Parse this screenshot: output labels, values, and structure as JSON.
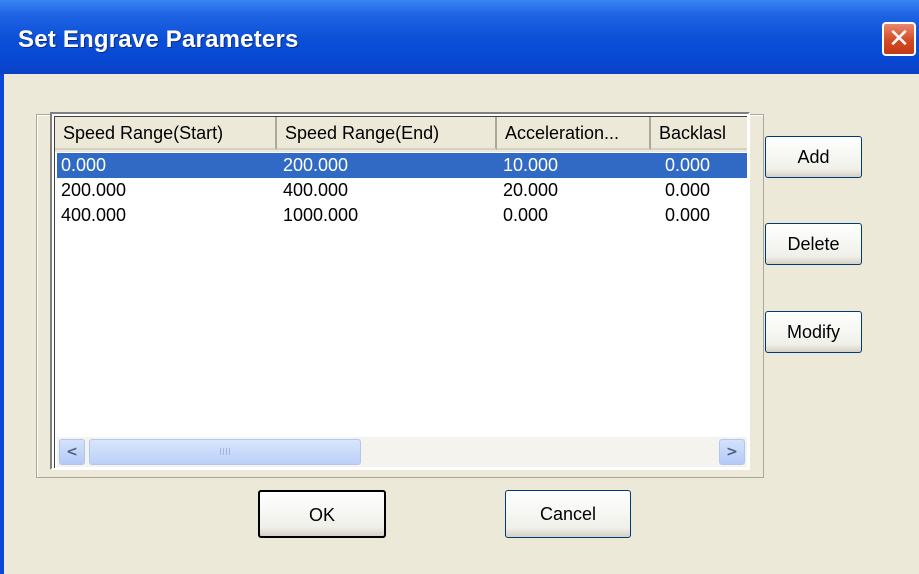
{
  "dialog": {
    "title": "Set Engrave Parameters",
    "close_glyph": "✕",
    "accent_color": "#0a46d8"
  },
  "table": {
    "columns": [
      "Speed Range(Start)",
      "Speed Range(End)",
      "Acceleration...",
      "Backlasl"
    ],
    "rows": [
      [
        "0.000",
        "200.000",
        "10.000",
        "0.000"
      ],
      [
        "200.000",
        "400.000",
        "20.000",
        "0.000"
      ],
      [
        "400.000",
        "1000.000",
        "0.000",
        "0.000"
      ]
    ],
    "selected_row": 0,
    "selection_color": "#316ac5"
  },
  "scrollbar": {
    "left_arrow": "<",
    "right_arrow": ">",
    "thumb_grip": "IIII"
  },
  "buttons": {
    "add": "Add",
    "delete": "Delete",
    "modify": "Modify",
    "ok": "OK",
    "cancel": "Cancel"
  }
}
